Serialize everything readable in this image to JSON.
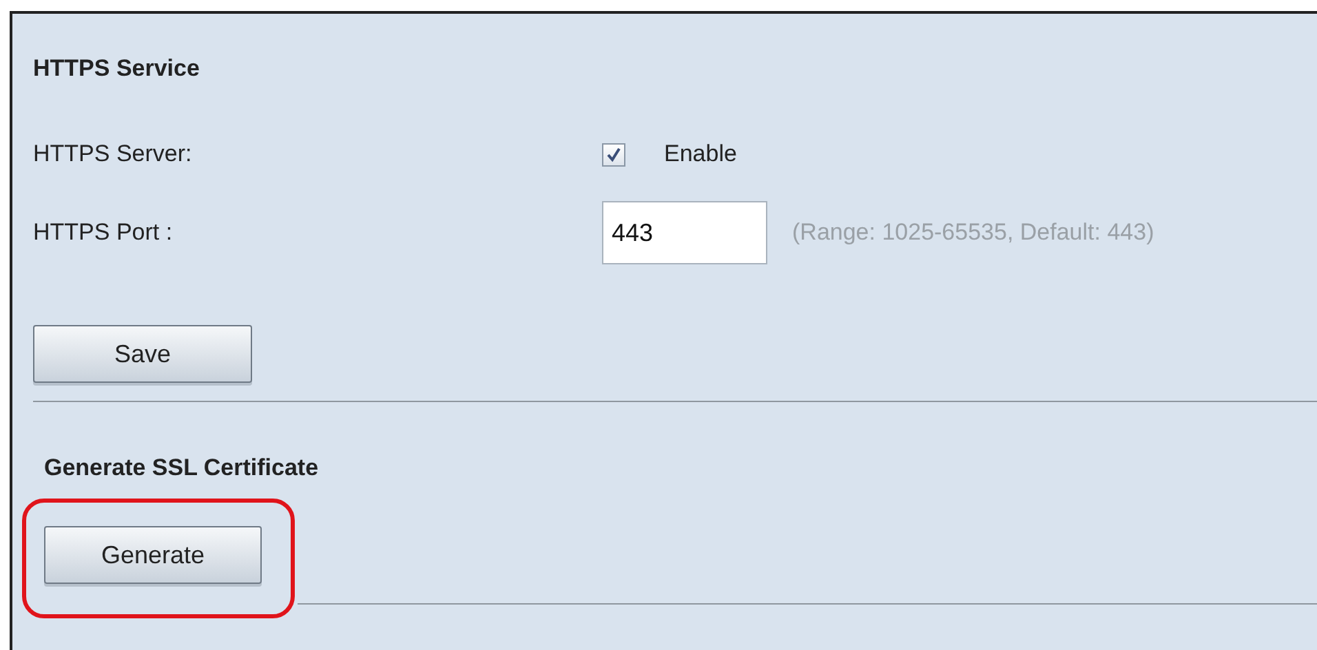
{
  "https_service": {
    "title": "HTTPS Service",
    "server": {
      "label": "HTTPS Server:",
      "checked": true,
      "option": "Enable"
    },
    "port": {
      "label": "HTTPS Port :",
      "value": "443",
      "hint": "(Range: 1025-65535, Default: 443)"
    },
    "save_button": "Save"
  },
  "ssl_certificate": {
    "title": "Generate SSL Certificate",
    "generate_button": "Generate",
    "highlighted": true
  }
}
